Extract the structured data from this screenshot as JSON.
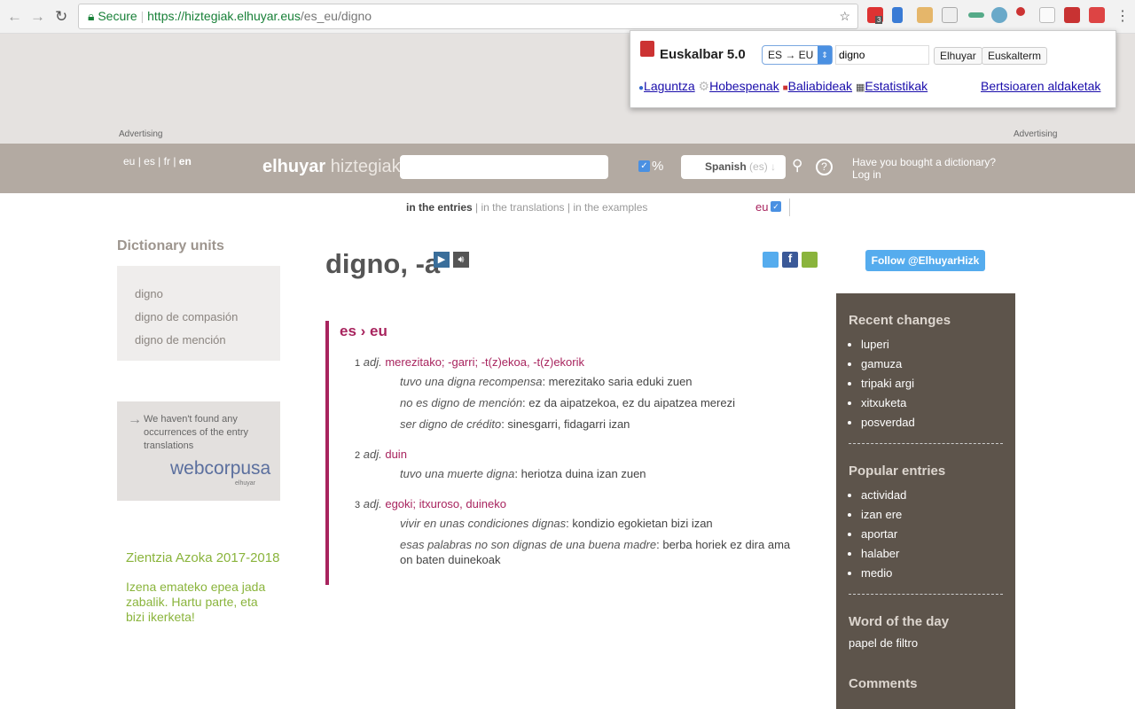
{
  "browser": {
    "secure_label": "Secure",
    "url_host": "https://hiztegiak.elhuyar.eus",
    "url_path": "/es_eu/digno",
    "badge_count": "3"
  },
  "popup": {
    "title": "Euskalbar 5.0",
    "direction": "ES → EU",
    "query": "digno",
    "buttons": [
      "Elhuyar",
      "Euskalterm"
    ],
    "links": [
      "Laguntza",
      "Hobespenak",
      "Baliabideak",
      "Estatistikak",
      "Bertsioaren aldaketak"
    ]
  },
  "ads": {
    "left": "Advertising",
    "right": "Advertising"
  },
  "header": {
    "langs": [
      "eu",
      "es",
      "fr",
      "en"
    ],
    "logo_bold": "elhuyar",
    "logo_light": "hiztegiak",
    "search_value": "",
    "percent": "%",
    "lang_select": "Spanish",
    "lang_code": "(es)",
    "account_line1": "Have you bought a dictionary?",
    "account_line2": "Log in"
  },
  "scope": {
    "entries": "in the entries",
    "translations": "in the translations",
    "examples": "in the examples",
    "eu": "eu"
  },
  "left": {
    "units_title": "Dictionary units",
    "units": [
      "digno",
      "digno de compasión",
      "digno de mención"
    ],
    "webcorpus_text": "We haven't found any occurrences of the entry translations",
    "webcorpus_logo": "webcorpusa",
    "webcorpus_sub": "elhuyar",
    "promo_title": "Zientzia Azoka 2017-2018",
    "promo_text": "Izena emateko epea jada zabalik. Hartu parte, eta bizi ikerketa!"
  },
  "entry": {
    "headword": "digno, -a",
    "direction": "es › eu",
    "senses": [
      {
        "num": "1",
        "pos": "adj.",
        "translation": "merezitako; -garri; -t(z)ekoa, -t(z)ekorik",
        "examples": [
          [
            "tuvo una digna recompensa",
            ": merezitako saria eduki zuen"
          ],
          [
            "no es digno de mención",
            ": ez da aipatzekoa, ez du aipatzea merezi"
          ],
          [
            "ser digno de crédito",
            ": sinesgarri, fidagarri izan"
          ]
        ]
      },
      {
        "num": "2",
        "pos": "adj.",
        "translation": "duin",
        "examples": [
          [
            "tuvo una muerte digna",
            ": heriotza duina izan zuen"
          ]
        ]
      },
      {
        "num": "3",
        "pos": "adj.",
        "translation": "egoki; itxuroso, duineko",
        "examples": [
          [
            "vivir en unas condiciones dignas",
            ": kondizio egokietan bizi izan"
          ],
          [
            "esas palabras no son dignas de una buena madre",
            ": berba horiek ez dira ama on baten duinekoak"
          ]
        ]
      }
    ]
  },
  "follow": "Follow @ElhuyarHizk",
  "sidebar": {
    "recent_title": "Recent changes",
    "recent": [
      "luperi",
      "gamuza",
      "tripaki argi",
      "xitxuketa",
      "posverdad"
    ],
    "popular_title": "Popular entries",
    "popular": [
      "actividad",
      "izan ere",
      "aportar",
      "halaber",
      "medio"
    ],
    "wotd_title": "Word of the day",
    "wotd": "papel de filtro",
    "comments_title": "Comments"
  }
}
